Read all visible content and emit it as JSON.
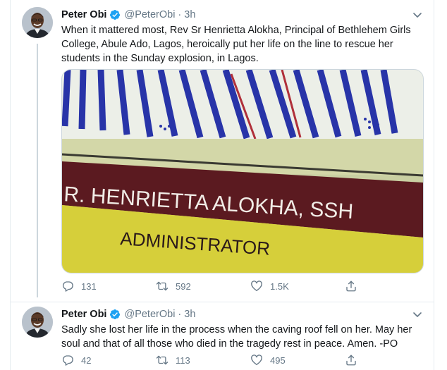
{
  "tweets": [
    {
      "author_name": "Peter Obi",
      "handle": "@PeterObi",
      "separator": "·",
      "time": "3h",
      "text": "When it mattered most, Rev Sr Henrietta Alokha, Principal of Bethlehem Girls College, Abule Ado, Lagos, heroically put her life on the line to rescue her students in the Sunday explosion, in Lagos.",
      "image": {
        "sign_line_1": "R. HENRIETTA ALOKHA, SSH",
        "sign_line_2": "ADMINISTRATOR"
      },
      "replies": "131",
      "retweets": "592",
      "likes": "1.5K"
    },
    {
      "author_name": "Peter Obi",
      "handle": "@PeterObi",
      "separator": "·",
      "time": "3h",
      "text": "Sadly she lost her life in the process when the caving roof fell on her. May her soul and that of all those who died in the tragedy rest in peace. Amen. -PO",
      "replies": "42",
      "retweets": "113",
      "likes": "495"
    }
  ],
  "icons": {
    "reply": "reply-icon",
    "retweet": "retweet-icon",
    "like": "heart-icon",
    "share": "share-icon",
    "verified": "verified-badge-icon",
    "menu": "chevron-down-icon"
  },
  "colors": {
    "text": "#14171a",
    "secondary": "#657786",
    "verified": "#1da1f2",
    "border": "#e6ecf0"
  }
}
